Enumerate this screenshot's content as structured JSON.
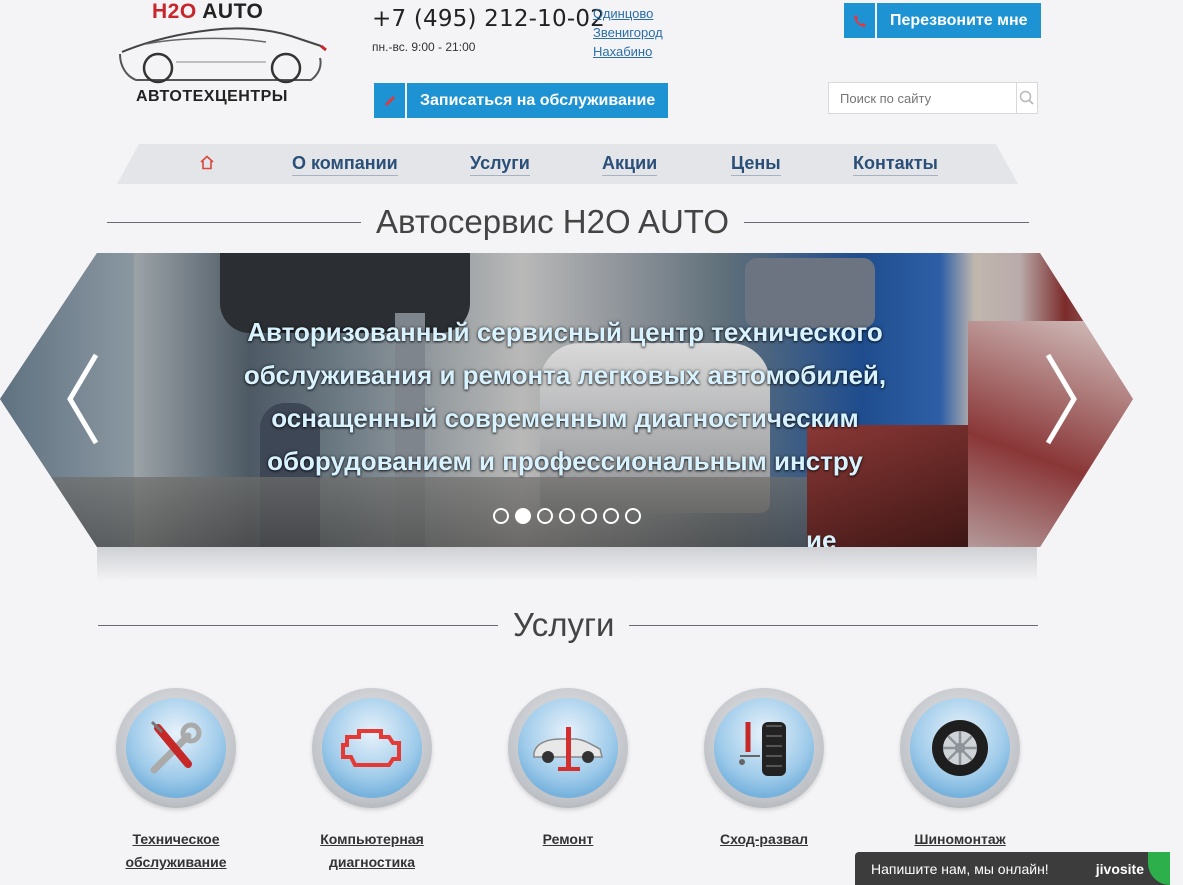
{
  "logo": {
    "brand_h2o": "H2O",
    "brand_auto": "AUTO",
    "subtitle": "АВТОТЕХЦЕНТРЫ"
  },
  "contact": {
    "phone": "+7 (495) 212-10-02",
    "hours": "пн.-вс. 9:00 - 21:00",
    "cities": [
      "Одинцово",
      "Звенигород",
      "Нахабино"
    ]
  },
  "buttons": {
    "call_label": "Перезвоните мне",
    "book_label": "Записаться на обслуживание"
  },
  "search": {
    "placeholder": "Поиск по сайту"
  },
  "nav": {
    "items": [
      "О компании",
      "Услуги",
      "Акции",
      "Цены",
      "Контакты"
    ]
  },
  "titles": {
    "main": "Автосервис H2O AUTO",
    "services": "Услуги"
  },
  "slider": {
    "text": "Авторизованный сервисный центр технического обслуживания и ремонта легковых автомобилей, оснащенный современным диагностическим оборудованием и профессиональным инстру",
    "partial_text": "ие",
    "slide_count": 7,
    "active_index": 1
  },
  "services": [
    {
      "label": "Техническое обслуживание",
      "icon": "wrench-screwdriver-icon"
    },
    {
      "label": "Компьютерная диагностика",
      "icon": "engine-check-icon"
    },
    {
      "label": "Ремонт",
      "icon": "car-lift-icon"
    },
    {
      "label": "Сход-развал",
      "icon": "wheel-alignment-icon"
    },
    {
      "label": "Шиномонтаж",
      "icon": "tire-icon"
    }
  ],
  "chat": {
    "text": "Напишите нам, мы онлайн!",
    "brand": "jivosite"
  },
  "colors": {
    "accent": "#1d93d4",
    "nav_text": "#2a4f78",
    "logo_red": "#c8262b",
    "link": "#2c6fa8"
  }
}
